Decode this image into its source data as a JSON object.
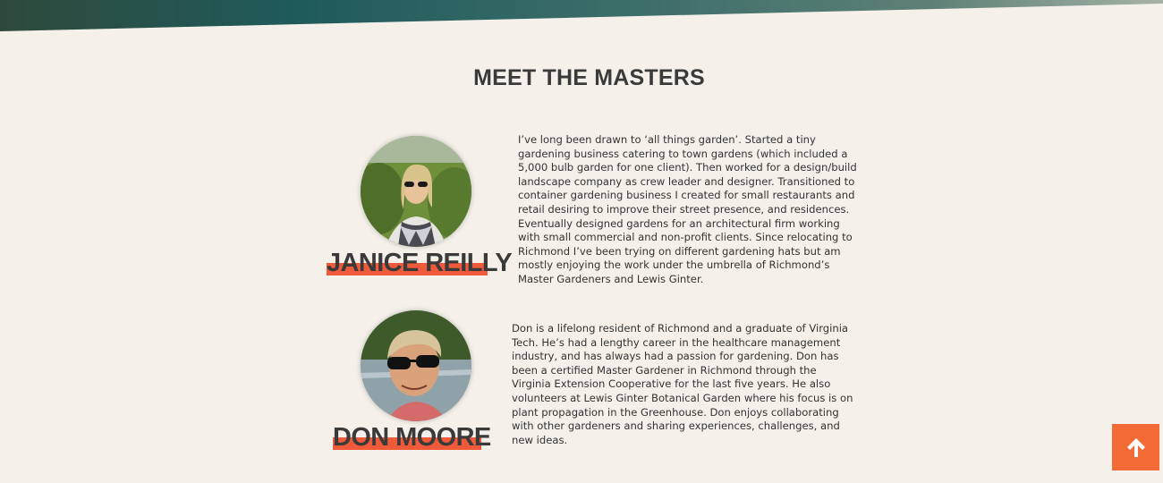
{
  "section": {
    "title": "MEET THE MASTERS"
  },
  "members": [
    {
      "name": "JANICE REILLY",
      "bio": "I’ve long been drawn to ‘all things garden’. Started a tiny gardening business catering to town gardens (which included a 5,000 bulb garden for one client). Then worked for a design/build landscape company as crew leader and designer. Transitioned to container gardening business I created for small restaurants and retail desiring to improve their street presence, and residences. Eventually designed gardens for an architectural firm working with small commercial and non-profit clients. Since relocating to Richmond I’ve been trying on different gardening hats but am mostly enjoying the work under the umbrella of Richmond’s Master Gardeners and Lewis Ginter."
    },
    {
      "name": "DON MOORE",
      "bio": "Don is a lifelong resident of Richmond and a graduate of Virginia Tech. He’s had a lengthy career in the healthcare management industry, and has always had a passion for gardening. Don has been a certified Master Gardener in Richmond through the Virginia Extension Cooperative for the last five years. He also volunteers at Lewis Ginter Botanical Garden where his focus is on plant propagation in the Greenhouse. Don enjoys collaborating with other gardeners and sharing experiences, challenges, and new ideas."
    }
  ],
  "scroll_top": {
    "icon": "arrow-up-icon"
  },
  "colors": {
    "background": "#f5f1ea",
    "accent": "#f26b36",
    "name_highlight": "#ef5a3a",
    "heading": "#3a3a3a"
  }
}
